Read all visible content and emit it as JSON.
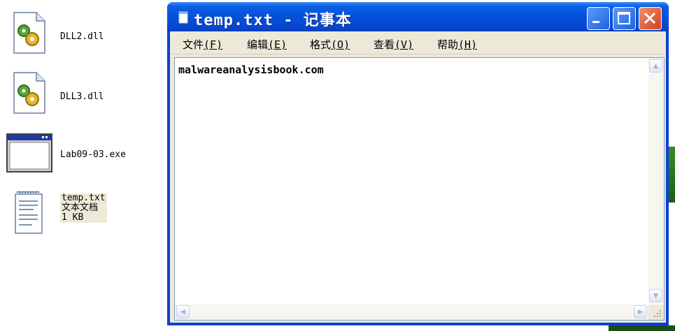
{
  "desktop": {
    "items": [
      {
        "label": "DLL2.dll"
      },
      {
        "label": "DLL3.dll"
      },
      {
        "label": "Lab09-03.exe"
      },
      {
        "label": "temp.txt\n文本文档\n1 KB"
      }
    ]
  },
  "window": {
    "title": "temp.txt - 记事本",
    "menu": [
      {
        "label": "文件",
        "accel": "(F)"
      },
      {
        "label": "编辑",
        "accel": "(E)"
      },
      {
        "label": "格式",
        "accel": "(O)"
      },
      {
        "label": "查看",
        "accel": "(V)"
      },
      {
        "label": "帮助",
        "accel": "(H)"
      }
    ],
    "content": "malwareanalysisbook.com"
  },
  "colors": {
    "titlebar": "#0550d8",
    "frame": "#ece9d8",
    "close_button": "#d0411c"
  }
}
